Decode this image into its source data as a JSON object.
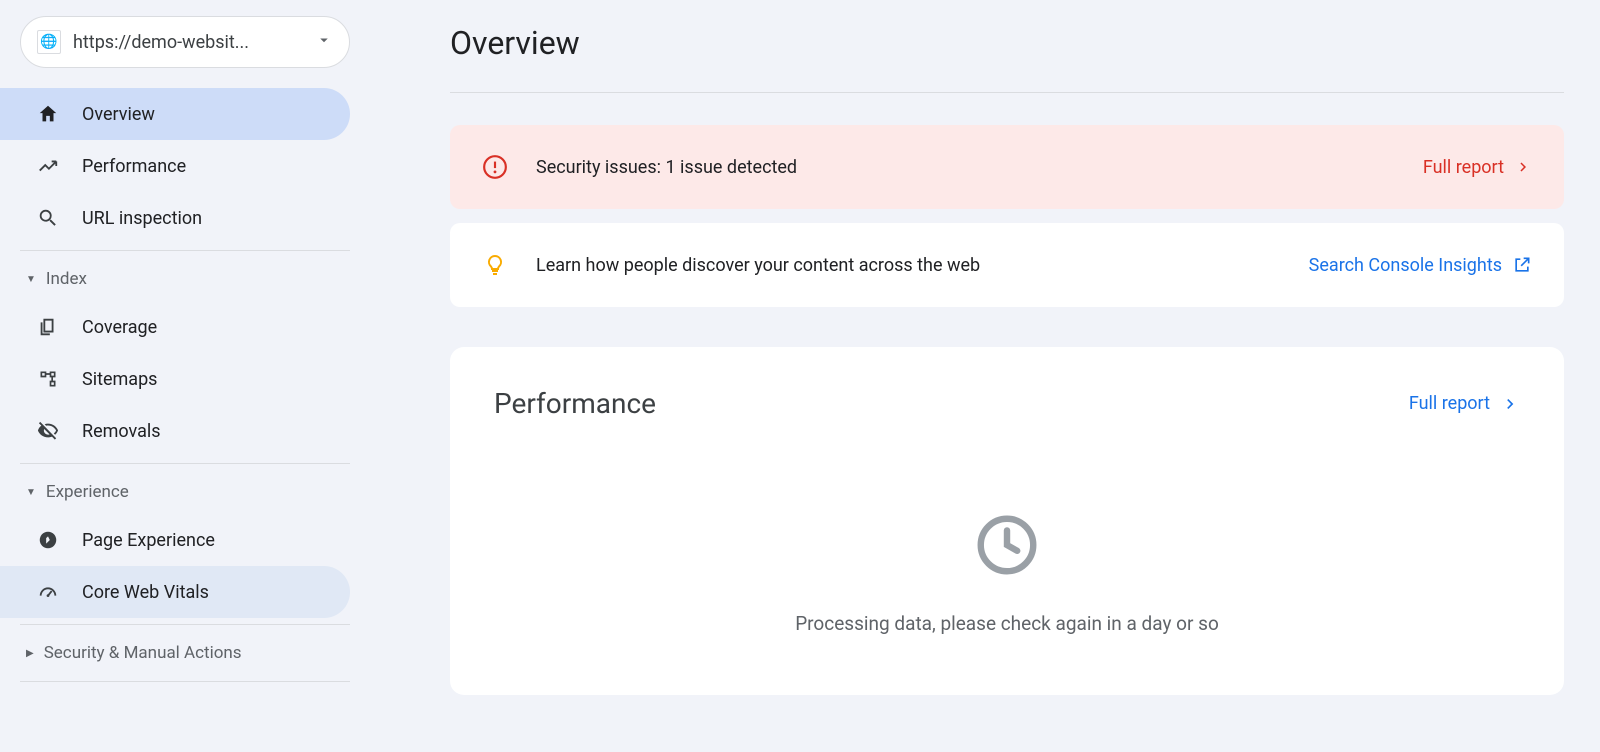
{
  "property": {
    "url": "https://demo-websit..."
  },
  "sidebar": {
    "overview": "Overview",
    "performance": "Performance",
    "url_inspection": "URL inspection",
    "index_section": "Index",
    "coverage": "Coverage",
    "sitemaps": "Sitemaps",
    "removals": "Removals",
    "experience_section": "Experience",
    "page_experience": "Page Experience",
    "core_web_vitals": "Core Web Vitals",
    "security_section": "Security & Manual Actions"
  },
  "main": {
    "title": "Overview",
    "security_banner": {
      "text": "Security issues: 1 issue detected",
      "link": "Full report"
    },
    "insights_banner": {
      "text": "Learn how people discover your content across the web",
      "link": "Search Console Insights"
    },
    "performance_card": {
      "title": "Performance",
      "link": "Full report",
      "empty_message": "Processing data, please check again in a day or so"
    }
  }
}
